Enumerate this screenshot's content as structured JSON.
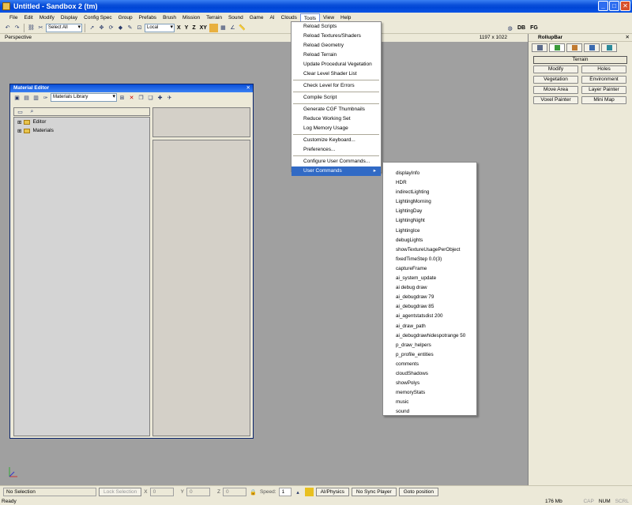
{
  "window": {
    "title": "Untitled - Sandbox 2 (tm)"
  },
  "menu": [
    {
      "label": "File"
    },
    {
      "label": "Edit"
    },
    {
      "label": "Modify"
    },
    {
      "label": "Display"
    },
    {
      "label": "Config Spec"
    },
    {
      "label": "Group"
    },
    {
      "label": "Prefabs"
    },
    {
      "label": "Brush"
    },
    {
      "label": "Mission"
    },
    {
      "label": "Terrain"
    },
    {
      "label": "Sound"
    },
    {
      "label": "Game"
    },
    {
      "label": "AI"
    },
    {
      "label": "Clouds"
    },
    {
      "label": "Tools",
      "active": true
    },
    {
      "label": "View"
    },
    {
      "label": "Help"
    }
  ],
  "toolbar": {
    "select_all": "Select All",
    "coord_system": "Local",
    "axes": [
      "X",
      "Y",
      "Z",
      "XY"
    ],
    "right_labels": [
      "DB",
      "FG"
    ]
  },
  "viewport": {
    "label": "Perspective",
    "dims": "1197 x 1022"
  },
  "material_editor": {
    "title": "Material Editor",
    "library_select": "Materials Library",
    "tree": [
      {
        "label": "Editor"
      },
      {
        "label": "Materials"
      }
    ]
  },
  "tools_menu": {
    "groups": [
      [
        "Reload Scripts",
        "Reload Textures/Shaders",
        "Reload Geometry",
        "Reload Terrain",
        "Update Procedural Vegetation",
        "Clear Level Shader List"
      ],
      [
        "Check Level for Errors"
      ],
      [
        "Compile Script"
      ],
      [
        "Generate CGF Thumbnails",
        "Reduce Working Set",
        "Log Memory Usage"
      ],
      [
        "Customize Keyboard...",
        "Preferences..."
      ],
      [
        "Configure User Commands..."
      ]
    ],
    "highlighted": "User Commands"
  },
  "user_commands": [
    "displayInfo",
    "HDR",
    "indirectLighting",
    "LightingMorning",
    "LightingDay",
    "LightingNight",
    "LightingIce",
    "debugLights",
    "showTextureUsagePerObject",
    "fixedTimeStep 0.0(3)",
    "captureFrame",
    "ai_system_update",
    "ai debug draw",
    "ai_debugdraw 79",
    "ai_debugdraw 85",
    "ai_agentstatsdist 200",
    "ai_draw_path",
    "ai_debugdrawhidespotrange 50",
    "p_draw_helpers",
    "p_profile_entities",
    "comments",
    "cloudShadows",
    "showPolys",
    "memoryStats",
    "music",
    "sound"
  ],
  "rollup": {
    "title": "RollupBar",
    "section": "Terrain",
    "buttons": [
      "Modify",
      "Holes",
      "Vegetation",
      "Environment",
      "Move Area",
      "Layer Painter",
      "Voxel Painter",
      "Mini Map"
    ],
    "tab_colors": [
      "#5a6a8a",
      "#3a9a3a",
      "#c07a30",
      "#3a6ab0",
      "#2a8a9a"
    ]
  },
  "status": {
    "selection": "No Selection",
    "lock_selection": "Lock Selection",
    "x_label": "X",
    "x_value": "0",
    "y_label": "Y",
    "y_value": "0",
    "z_label": "Z",
    "z_value": "0",
    "speed_label": "Speed:",
    "speed_value": "1",
    "ai_physics": "AI/Physics",
    "sync_player": "No Sync Player",
    "goto_position": "Goto position",
    "ready": "Ready",
    "memory": "176 Mb",
    "keys": [
      "CAP",
      "NUM",
      "SCRL"
    ]
  }
}
